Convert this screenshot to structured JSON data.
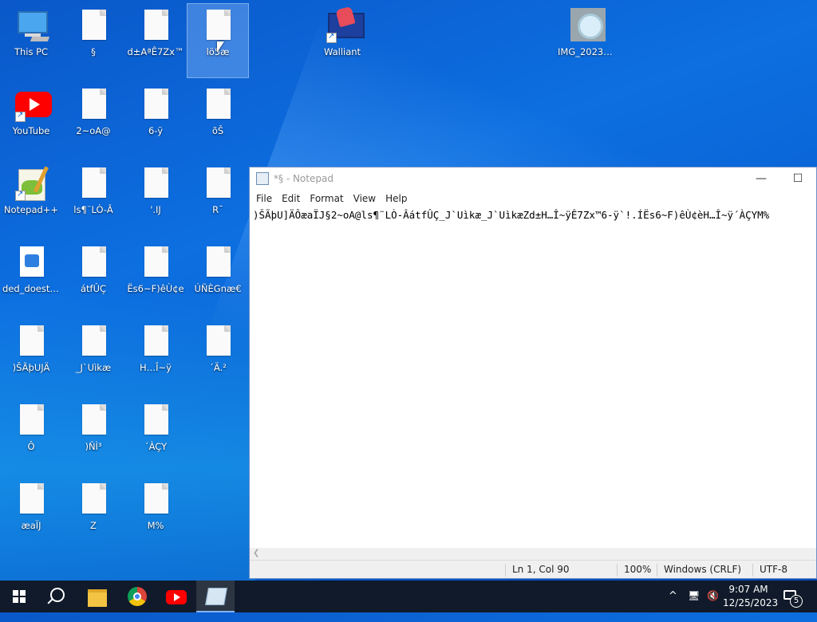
{
  "desktop": {
    "icons": [
      {
        "label": "This PC",
        "type": "pc"
      },
      {
        "label": "§",
        "type": "file"
      },
      {
        "label": "d±AªÊ7Zx™",
        "type": "file"
      },
      {
        "label": "lö5­æ",
        "type": "file",
        "selected": true
      },
      {
        "label": "Walliant",
        "type": "walliant",
        "shortcut": true
      },
      {
        "label": "IMG_20231...",
        "type": "photo"
      },
      {
        "label": "YouTube",
        "type": "youtube",
        "shortcut": true
      },
      {
        "label": "2~oA@",
        "type": "file"
      },
      {
        "label": "6-ÿ",
        "type": "file"
      },
      {
        "label": "õŠ",
        "type": "file"
      },
      {
        "label": "Notepad++",
        "type": "npp",
        "shortcut": true
      },
      {
        "label": "ls¶¨LÒ-Â",
        "type": "file"
      },
      {
        "label": "'.IJ",
        "type": "file"
      },
      {
        "label": "R¯",
        "type": "file"
      },
      {
        "label": "ded_doest_...",
        "type": "image"
      },
      {
        "label": "átfÛÇ",
        "type": "file"
      },
      {
        "label": "Ës6~F)êÙ¢e",
        "type": "file"
      },
      {
        "label": "ÚÑÈGnæ€",
        "type": "file"
      },
      {
        "label": ")ŠÃþUJÄ",
        "type": "file"
      },
      {
        "label": "_J`Uìkæ",
        "type": "file"
      },
      {
        "label": "H…Î~ÿ",
        "type": "file"
      },
      {
        "label": "´Ä.²",
        "type": "file"
      },
      {
        "label": "Ô",
        "type": "file"
      },
      {
        "label": ")ÑÌ³",
        "type": "file"
      },
      {
        "label": "´ÀÇY",
        "type": "file"
      },
      {
        "label": "æaÏJ",
        "type": "file"
      },
      {
        "label": "Z",
        "type": "file"
      },
      {
        "label": "M%",
        "type": "file"
      }
    ]
  },
  "notepad": {
    "title": "*§ - Notepad",
    "menu": [
      "File",
      "Edit",
      "Format",
      "View",
      "Help"
    ],
    "content": ")ŠÃþU]ÄÔæaÏJ§2~oA@ls¶¨LÒ-ÂátfÛÇ_J`Uìkæ_J`UìkæZd±H…Î~ÿÊ7Zx™6-ÿ`!.ÍËs6~F)êÙ¢èH…Î~ÿ´ÀÇYM%",
    "status": {
      "position": "Ln 1, Col 90",
      "zoom": "100%",
      "line_ending": "Windows (CRLF)",
      "encoding": "UTF-8"
    }
  },
  "taskbar": {
    "items": [
      "start-button",
      "search-button",
      "file-explorer",
      "chrome",
      "youtube",
      "notepad"
    ],
    "tray": {
      "chevron": "^",
      "time": "9:07 AM",
      "date": "12/25/2023",
      "notifications": "5"
    }
  }
}
